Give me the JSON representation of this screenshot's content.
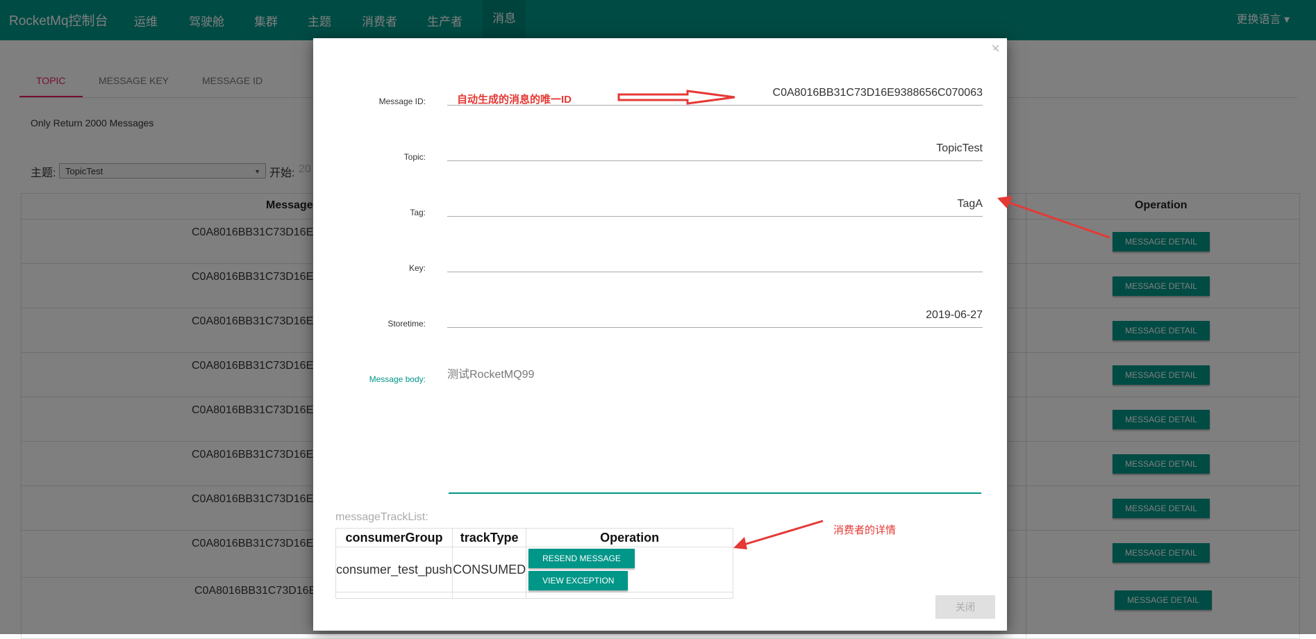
{
  "navbar": {
    "brand": "RocketMq控制台",
    "items": [
      "运维",
      "驾驶舱",
      "集群",
      "主题",
      "消费者",
      "生产者",
      "消息"
    ],
    "active": "消息",
    "language": "更换语言 ▾"
  },
  "page": {
    "tabs": [
      "TOPIC",
      "MESSAGE KEY",
      "MESSAGE ID"
    ],
    "active_tab": "TOPIC",
    "only_return": "Only Return 2000 Messages",
    "topic_label": "主题:",
    "topic_value": "TopicTest",
    "start_label": "开始:",
    "start_value": "20",
    "columns": {
      "message": "Message",
      "operation": "Operation"
    },
    "rows": [
      "C0A8016BB31C73D16E",
      "C0A8016BB31C73D16E",
      "C0A8016BB31C73D16E",
      "C0A8016BB31C73D16E",
      "C0A8016BB31C73D16E",
      "C0A8016BB31C73D16E",
      "C0A8016BB31C73D16E",
      "C0A8016BB31C73D16E",
      "C0A8016BB31C73D16E"
    ],
    "row_button": "MESSAGE DETAIL"
  },
  "modal": {
    "close": "×",
    "fields": {
      "message_id": {
        "label": "Message ID:",
        "value": "C0A8016BB31C73D16E9388656C070063"
      },
      "topic": {
        "label": "Topic:",
        "value": "TopicTest"
      },
      "tag": {
        "label": "Tag:",
        "value": "TagA"
      },
      "key": {
        "label": "Key:",
        "value": ""
      },
      "storetime": {
        "label": "Storetime:",
        "value": "2019-06-27"
      },
      "body": {
        "label": "Message body:",
        "value": "测试RocketMQ99"
      }
    },
    "annotations": {
      "id_note": "自动生成的消息的唯一ID",
      "consumer_note": "消费者的详情"
    },
    "track": {
      "label": "messageTrackList:",
      "headers": [
        "consumerGroup",
        "trackType",
        "Operation"
      ],
      "rows": [
        {
          "consumer_group": "consumer_test_push",
          "track_type": "CONSUMED"
        }
      ],
      "resend": "RESEND MESSAGE",
      "view_exception": "VIEW EXCEPTION"
    },
    "footer_button": "关闭"
  },
  "colors": {
    "primary": "#009688",
    "annotation": "#e53935",
    "active_tab": "#e91e63"
  }
}
